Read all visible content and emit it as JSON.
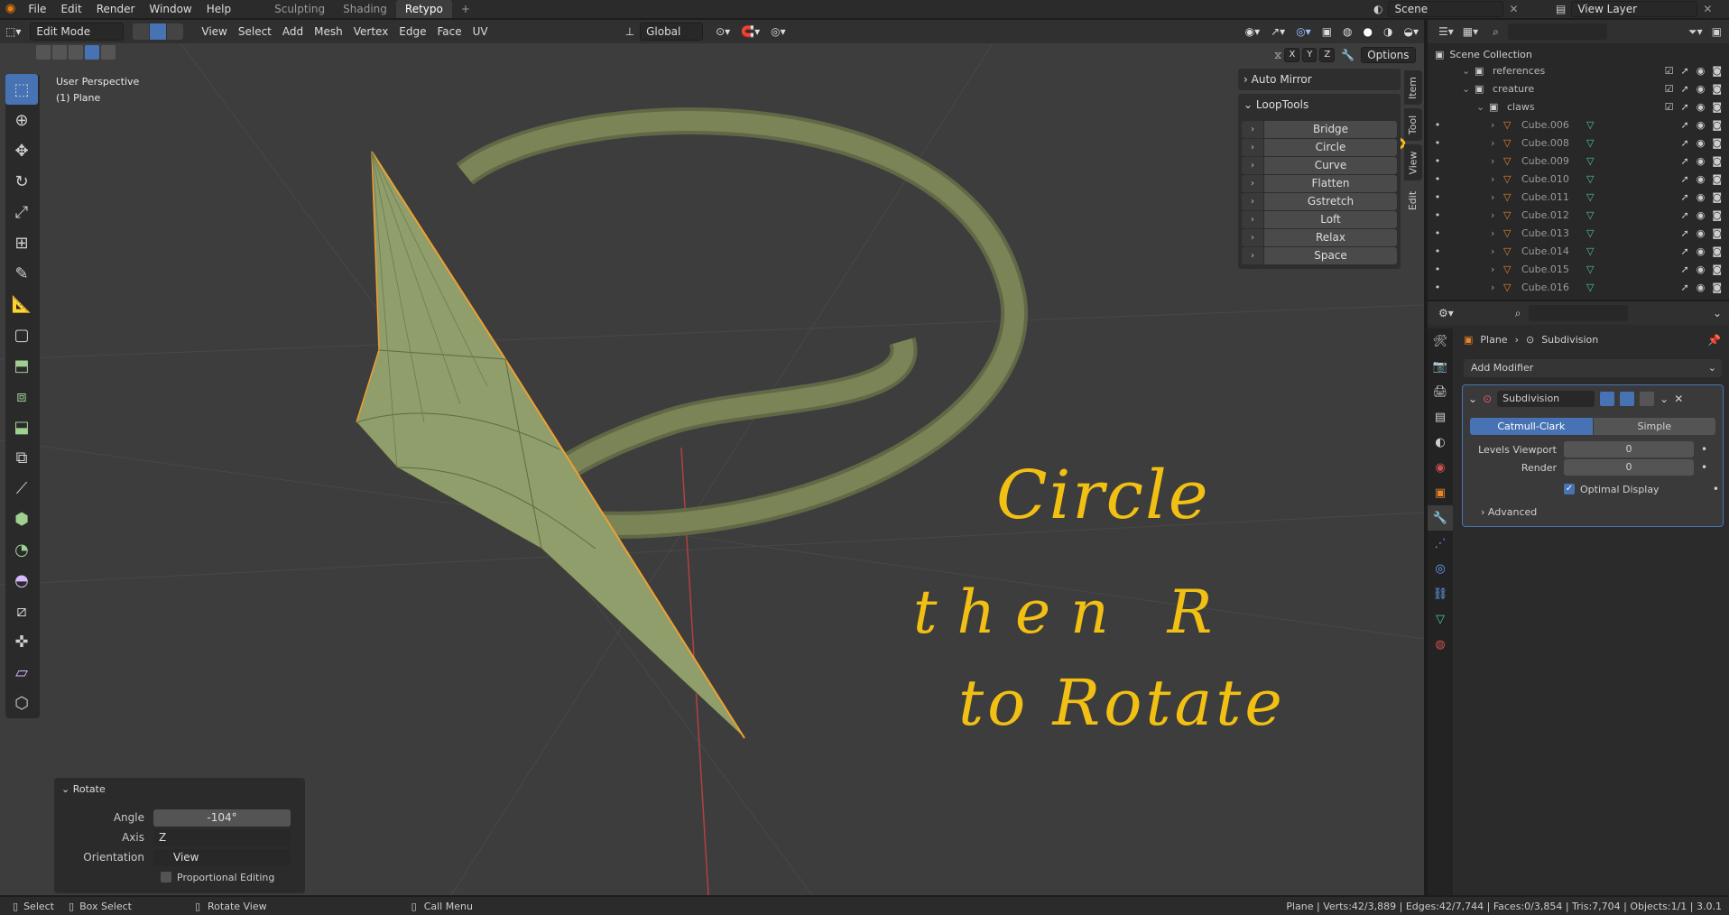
{
  "topbar": {
    "menus": [
      "File",
      "Edit",
      "Render",
      "Window",
      "Help"
    ],
    "workspaces": [
      "Sculpting",
      "Shading",
      "Retypo"
    ],
    "active_workspace": "Retypo",
    "add_tab": "+",
    "scene_label": "Scene",
    "view_layer_label": "View Layer"
  },
  "viewport_header": {
    "mode": "Edit Mode",
    "menus": [
      "View",
      "Select",
      "Add",
      "Mesh",
      "Vertex",
      "Edge",
      "Face",
      "UV"
    ],
    "orientation": "Global",
    "options": "Options",
    "axes": [
      "X",
      "Y",
      "Z"
    ]
  },
  "viewport": {
    "perspective": "User Perspective",
    "object": "(1) Plane"
  },
  "npanel": {
    "auto_mirror": "Auto Mirror",
    "looptools": "LoopTools",
    "items": [
      "Bridge",
      "Circle",
      "Curve",
      "Flatten",
      "Gstretch",
      "Loft",
      "Relax",
      "Space"
    ],
    "tabs": [
      "Item",
      "Tool",
      "View",
      "Edit"
    ]
  },
  "annotation": {
    "line1": "Circle",
    "line2": "then R",
    "line3": "to Rotate",
    "color": "#f2c012"
  },
  "rotate_panel": {
    "title": "Rotate",
    "angle_label": "Angle",
    "angle_value": "-104°",
    "axis_label": "Axis",
    "axis_value": "Z",
    "orientation_label": "Orientation",
    "orientation_value": "View",
    "proportional": "Proportional Editing"
  },
  "outliner": {
    "root": "Scene Collection",
    "rows": [
      {
        "name": "references",
        "indent": 1,
        "kind": "collection"
      },
      {
        "name": "creature",
        "indent": 1,
        "kind": "collection"
      },
      {
        "name": "claws",
        "indent": 2,
        "kind": "collection"
      },
      {
        "name": "Cube.006",
        "indent": 3,
        "kind": "mesh"
      },
      {
        "name": "Cube.008",
        "indent": 3,
        "kind": "mesh"
      },
      {
        "name": "Cube.009",
        "indent": 3,
        "kind": "mesh"
      },
      {
        "name": "Cube.010",
        "indent": 3,
        "kind": "mesh"
      },
      {
        "name": "Cube.011",
        "indent": 3,
        "kind": "mesh"
      },
      {
        "name": "Cube.012",
        "indent": 3,
        "kind": "mesh"
      },
      {
        "name": "Cube.013",
        "indent": 3,
        "kind": "mesh"
      },
      {
        "name": "Cube.014",
        "indent": 3,
        "kind": "mesh"
      },
      {
        "name": "Cube.015",
        "indent": 3,
        "kind": "mesh"
      },
      {
        "name": "Cube.016",
        "indent": 3,
        "kind": "mesh"
      }
    ]
  },
  "properties": {
    "breadcrumb_object": "Plane",
    "breadcrumb_modifier": "Subdivision",
    "add_modifier": "Add Modifier",
    "modifier_name": "Subdivision",
    "catmull": "Catmull-Clark",
    "simple": "Simple",
    "levels_viewport_label": "Levels Viewport",
    "levels_viewport": "0",
    "render_label": "Render",
    "render_value": "0",
    "optimal_display": "Optimal Display",
    "advanced": "Advanced"
  },
  "statusbar": {
    "select": "Select",
    "box_select": "Box Select",
    "rotate_view": "Rotate View",
    "call_menu": "Call Menu",
    "stats": "Plane | Verts:42/3,889 | Edges:42/7,744 | Faces:0/3,854 | Tris:7,704 | Objects:1/1 | 3.0.1"
  },
  "colors": {
    "accent": "#4772b3",
    "mesh": "#8f9e6a",
    "selected_edge": "#f0a030"
  }
}
